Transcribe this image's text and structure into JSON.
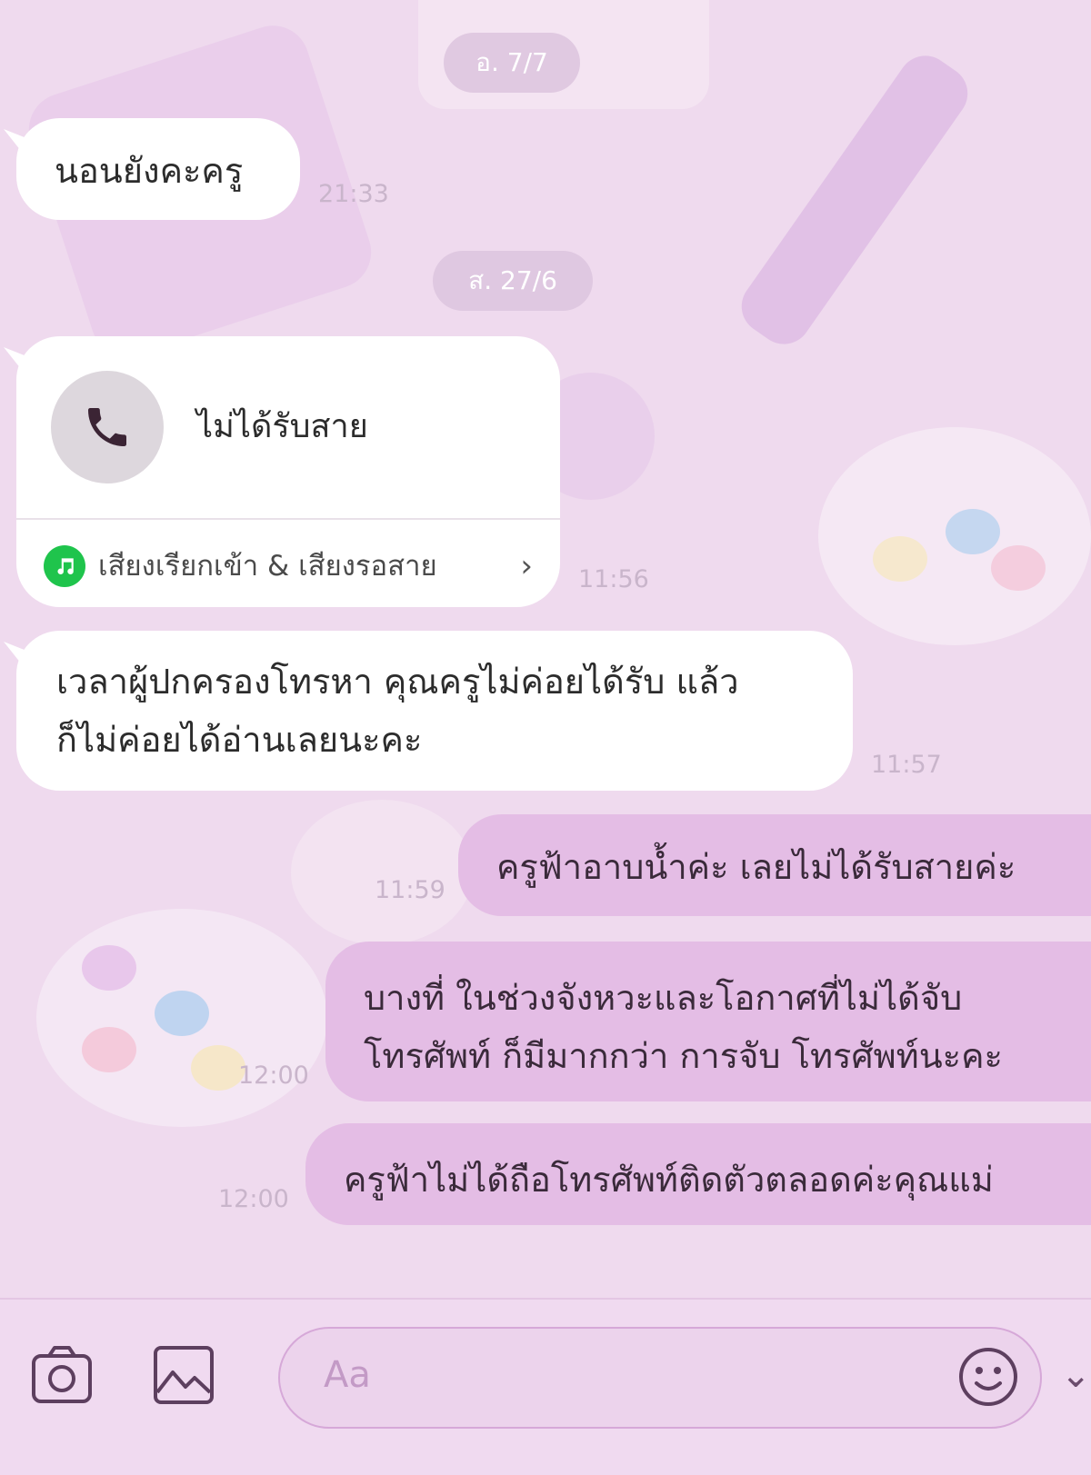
{
  "colors": {
    "background": "#efdaee",
    "incoming_bubble": "#ffffff",
    "outgoing_bubble": "#e4bde5",
    "timestamp": "#c9b5cb",
    "music_badge": "#1fc44c"
  },
  "chat": {
    "date_1": "อ. 7/7",
    "msg_1": {
      "text": "นอนยังคะครู",
      "time": "21:33"
    },
    "date_2": "ส. 27/6",
    "call_card": {
      "icon": "phone-icon",
      "label": "ไม่ได้รับสาย",
      "ringtone_label": "เสียงเรียกเข้า & เสียงรอสาย",
      "ringtone_icon": "music-note-icon",
      "chevron_icon": "chevron-right-icon",
      "time": "11:56"
    },
    "msg_2": {
      "line1": "เวลาผู้ปกครองโทรหา คุณครูไม่ค่อยได้รับ แล้ว",
      "line2": "ก็ไม่ค่อยได้อ่านเลยนะคะ",
      "time": "11:57"
    },
    "out_1": {
      "text": "ครูฟ้าอาบน้ำค่ะ เลยไม่ได้รับสายค่ะ",
      "time": "11:59"
    },
    "out_2": {
      "line1": "บางที่ ในช่วงจังหวะและโอกาศที่ไม่ได้จับ",
      "line2": "โทรศัพท์ ก็มีมากกว่า การจับ โทรศัพท์นะคะ",
      "time": "12:00"
    },
    "out_3": {
      "text": "ครูฟ้าไม่ได้ถือโทรศัพท์ติดตัวตลอดค่ะคุณแม่",
      "time": "12:00"
    }
  },
  "input_bar": {
    "camera_icon": "camera-icon",
    "image_icon": "image-icon",
    "placeholder": "Aa",
    "emoji_icon": "smiley-icon"
  }
}
